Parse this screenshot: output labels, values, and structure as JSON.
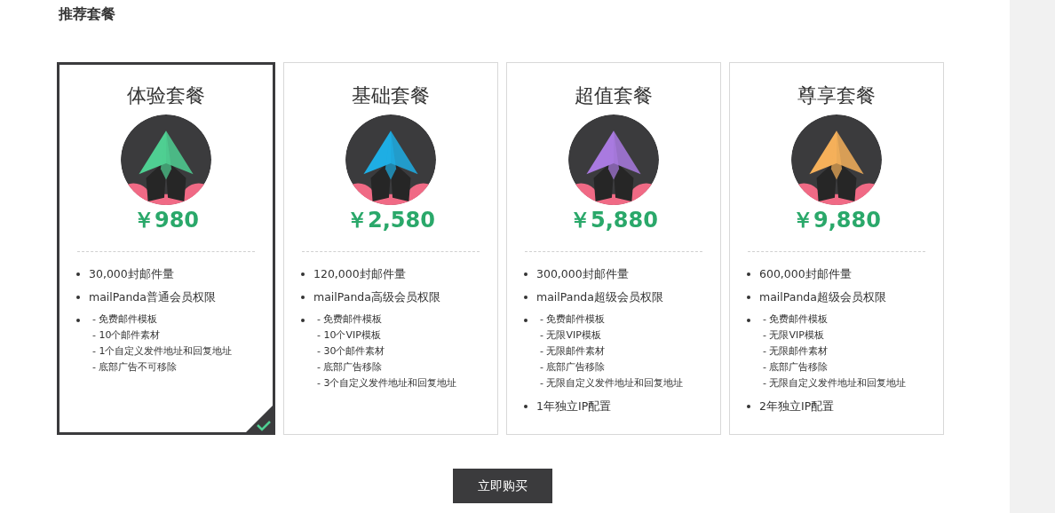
{
  "section_title": "推荐套餐",
  "plans": [
    {
      "name": "体验套餐",
      "color": "#4fcf92",
      "price": "￥980",
      "selected": true,
      "features": [
        {
          "kind": "text",
          "text": "30,000封邮件量"
        },
        {
          "kind": "text",
          "text": "mailPanda普通会员权限"
        },
        {
          "kind": "list",
          "items": [
            "- 免费邮件模板",
            "- 10个邮件素材",
            "- 1个自定义发件地址和回复地址",
            "- 底部广告不可移除"
          ]
        }
      ]
    },
    {
      "name": "基础套餐",
      "color": "#1eaee4",
      "price": "￥2,580",
      "selected": false,
      "features": [
        {
          "kind": "text",
          "text": "120,000封邮件量"
        },
        {
          "kind": "text",
          "text": "mailPanda高级会员权限"
        },
        {
          "kind": "list",
          "items": [
            "- 免费邮件模板",
            "- 10个VIP模板",
            "- 30个邮件素材",
            "- 底部广告移除",
            "- 3个自定义发件地址和回复地址"
          ]
        }
      ]
    },
    {
      "name": "超值套餐",
      "color": "#a97ae0",
      "price": "￥5,880",
      "selected": false,
      "features": [
        {
          "kind": "text",
          "text": "300,000封邮件量"
        },
        {
          "kind": "text",
          "text": "mailPanda超级会员权限"
        },
        {
          "kind": "list",
          "items": [
            "- 免费邮件模板",
            "- 无限VIP模板",
            "- 无限邮件素材",
            "- 底部广告移除",
            "- 无限自定义发件地址和回复地址"
          ]
        },
        {
          "kind": "text",
          "text": "1年独立IP配置"
        }
      ]
    },
    {
      "name": "尊享套餐",
      "color": "#f5b05a",
      "price": "￥9,880",
      "selected": false,
      "features": [
        {
          "kind": "text",
          "text": "600,000封邮件量"
        },
        {
          "kind": "text",
          "text": "mailPanda超级会员权限"
        },
        {
          "kind": "list",
          "items": [
            "- 免费邮件模板",
            "- 无限VIP模板",
            "- 无限邮件素材",
            "- 底部广告移除",
            "- 无限自定义发件地址和回复地址"
          ]
        },
        {
          "kind": "text",
          "text": "2年独立IP配置"
        }
      ]
    }
  ],
  "buy_button": "立即购买"
}
